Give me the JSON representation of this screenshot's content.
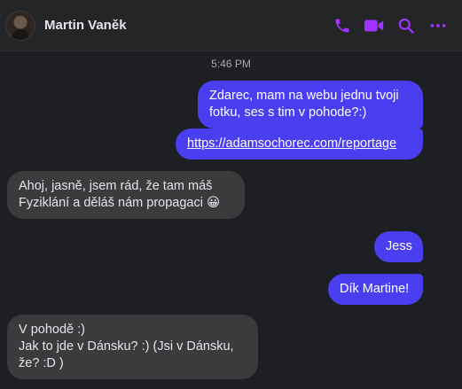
{
  "header": {
    "contact_name": "Martin Vaněk",
    "icons": [
      "phone-icon",
      "video-camera-icon",
      "search-icon",
      "more-options-icon"
    ],
    "accent_color": "#a033ff"
  },
  "conversation": {
    "timestamp": "5:46 PM",
    "messages": [
      {
        "direction": "outgoing",
        "text": "Zdarec, mam na webu jednu tvoji\nfotku, ses s tim v pohode?:)"
      },
      {
        "direction": "outgoing",
        "text": "https://adamsochorec.com/reportage",
        "type": "link"
      },
      {
        "direction": "incoming",
        "text": "Ahoj, jasně, jsem rád, že tam máš\nFyziklání a děláš nám propagaci 😀"
      },
      {
        "direction": "outgoing",
        "text": "Jess"
      },
      {
        "direction": "outgoing",
        "text": "Dík Martine!"
      },
      {
        "direction": "incoming",
        "text": "V pohodě :)\nJak to jde v Dánsku? :) (Jsi v Dánsku,\nže? :D )"
      }
    ]
  }
}
